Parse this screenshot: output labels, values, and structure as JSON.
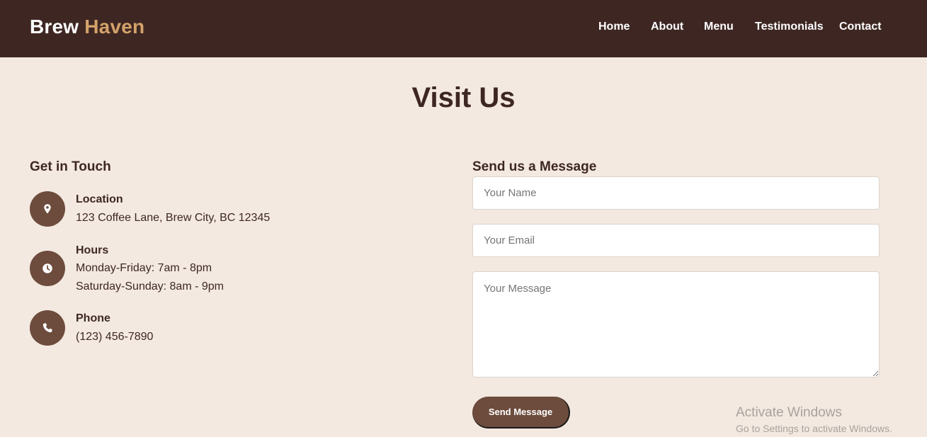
{
  "brand": {
    "name": "Brew",
    "accent": "Haven"
  },
  "nav": {
    "items": [
      "Home",
      "About",
      "Menu",
      "Testimonials",
      "Contact"
    ]
  },
  "page": {
    "title": "Visit Us"
  },
  "contact_info": {
    "heading": "Get in Touch",
    "location": {
      "label": "Location",
      "icon": "map-pin-icon",
      "lines": [
        "123 Coffee Lane, Brew City, BC 12345"
      ]
    },
    "hours": {
      "label": "Hours",
      "icon": "clock-icon",
      "lines": [
        "Monday-Friday: 7am - 8pm",
        "Saturday-Sunday: 8am - 9pm"
      ]
    },
    "phone": {
      "label": "Phone",
      "icon": "phone-icon",
      "lines": [
        "(123) 456-7890"
      ]
    }
  },
  "form": {
    "heading": "Send us a Message",
    "name": {
      "placeholder": "Your Name",
      "value": ""
    },
    "email": {
      "placeholder": "Your Email",
      "value": ""
    },
    "message": {
      "placeholder": "Your Message",
      "value": ""
    },
    "submit_label": "Send Message"
  },
  "watermark": {
    "title": "Activate Windows",
    "subtitle": "Go to Settings to activate Windows."
  },
  "colors": {
    "navbar": "#3e2723",
    "brand_accent": "#d4a26a",
    "background": "#f3e9e0",
    "icon_circle": "#6d4c3d",
    "button": "#6d4c3d"
  }
}
